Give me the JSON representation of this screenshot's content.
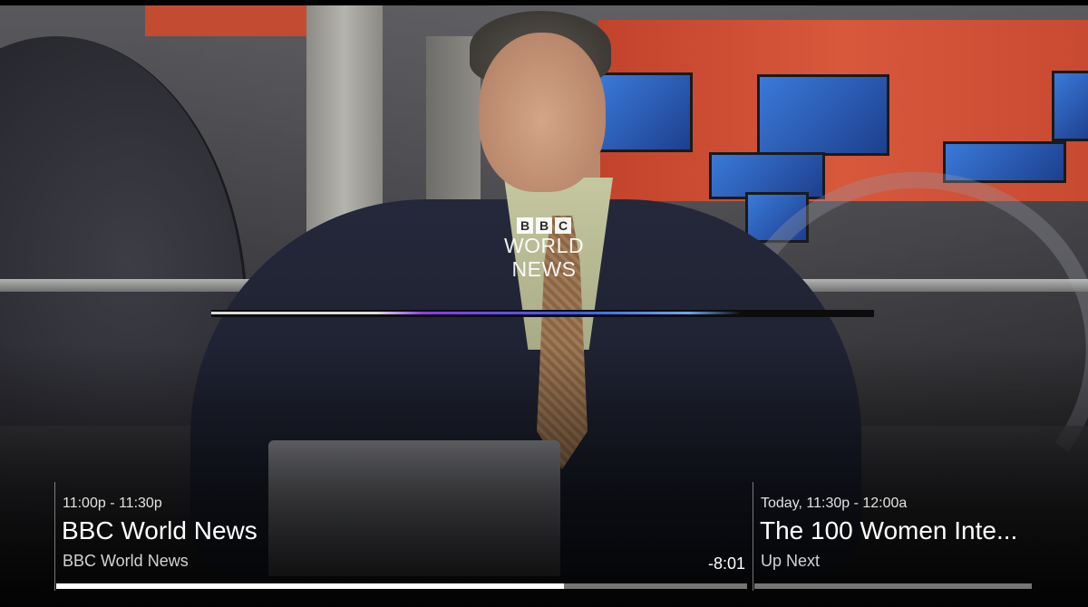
{
  "player": {
    "channel_logo": {
      "bbc_letters": [
        "B",
        "B",
        "C"
      ],
      "line1": "WORLD",
      "line2": "NEWS"
    },
    "current_program": {
      "time_range": "11:00p - 11:30p",
      "title": "BBC World News",
      "subtitle": "BBC World News",
      "remaining": "-8:01",
      "progress": 0.735
    },
    "next_program": {
      "time_range": "Today, 11:30p - 12:00a",
      "title": "The 100 Women Inte...",
      "subtitle": "Up Next"
    }
  },
  "colors": {
    "loading_gradient": [
      "#8a3cff",
      "#3f5cff",
      "#6da4ff"
    ],
    "progress_fill": "#ffffff",
    "studio_wall": "#d8583c"
  }
}
